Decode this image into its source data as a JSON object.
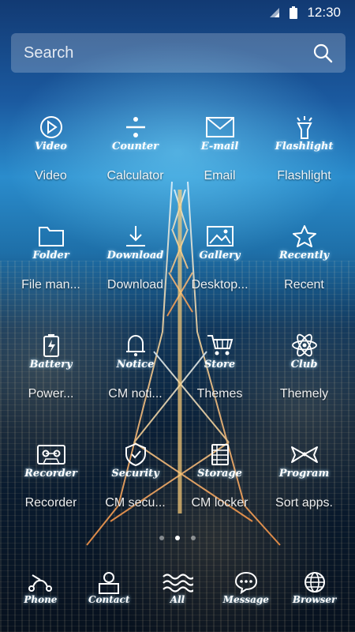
{
  "status_bar": {
    "time": "12:30",
    "icons": [
      "signal-icon",
      "battery-icon"
    ]
  },
  "search": {
    "placeholder": "Search"
  },
  "apps": [
    {
      "icon": "play-icon",
      "script": "Video",
      "label": "Video"
    },
    {
      "icon": "divide-icon",
      "script": "Counter",
      "label": "Calculator"
    },
    {
      "icon": "envelope-icon",
      "script": "E-mail",
      "label": "Email"
    },
    {
      "icon": "flashlight-icon",
      "script": "Flashlight",
      "label": "Flashlight"
    },
    {
      "icon": "folder-icon",
      "script": "Folder",
      "label": "File man..."
    },
    {
      "icon": "download-icon",
      "script": "Download",
      "label": "Download"
    },
    {
      "icon": "picture-icon",
      "script": "Gallery",
      "label": "Desktop..."
    },
    {
      "icon": "star-icon",
      "script": "Recently",
      "label": "Recent"
    },
    {
      "icon": "battery-charge-icon",
      "script": "Battery",
      "label": "Power..."
    },
    {
      "icon": "bell-icon",
      "script": "Notice",
      "label": "CM noti..."
    },
    {
      "icon": "cart-icon",
      "script": "Store",
      "label": "Themes"
    },
    {
      "icon": "atom-icon",
      "script": "Club",
      "label": "Themely"
    },
    {
      "icon": "cassette-icon",
      "script": "Recorder",
      "label": "Recorder"
    },
    {
      "icon": "shield-icon",
      "script": "Security",
      "label": "CM secu..."
    },
    {
      "icon": "storage-icon",
      "script": "Storage",
      "label": "CM locker"
    },
    {
      "icon": "bow-icon",
      "script": "Program",
      "label": "Sort apps."
    }
  ],
  "page_indicator": {
    "count": 3,
    "active": 2
  },
  "dock": [
    {
      "icon": "phone-icon",
      "script": "Phone"
    },
    {
      "icon": "contact-icon",
      "script": "Contact"
    },
    {
      "icon": "waves-icon",
      "script": "All"
    },
    {
      "icon": "message-icon",
      "script": "Message"
    },
    {
      "icon": "globe-icon",
      "script": "Browser"
    }
  ]
}
